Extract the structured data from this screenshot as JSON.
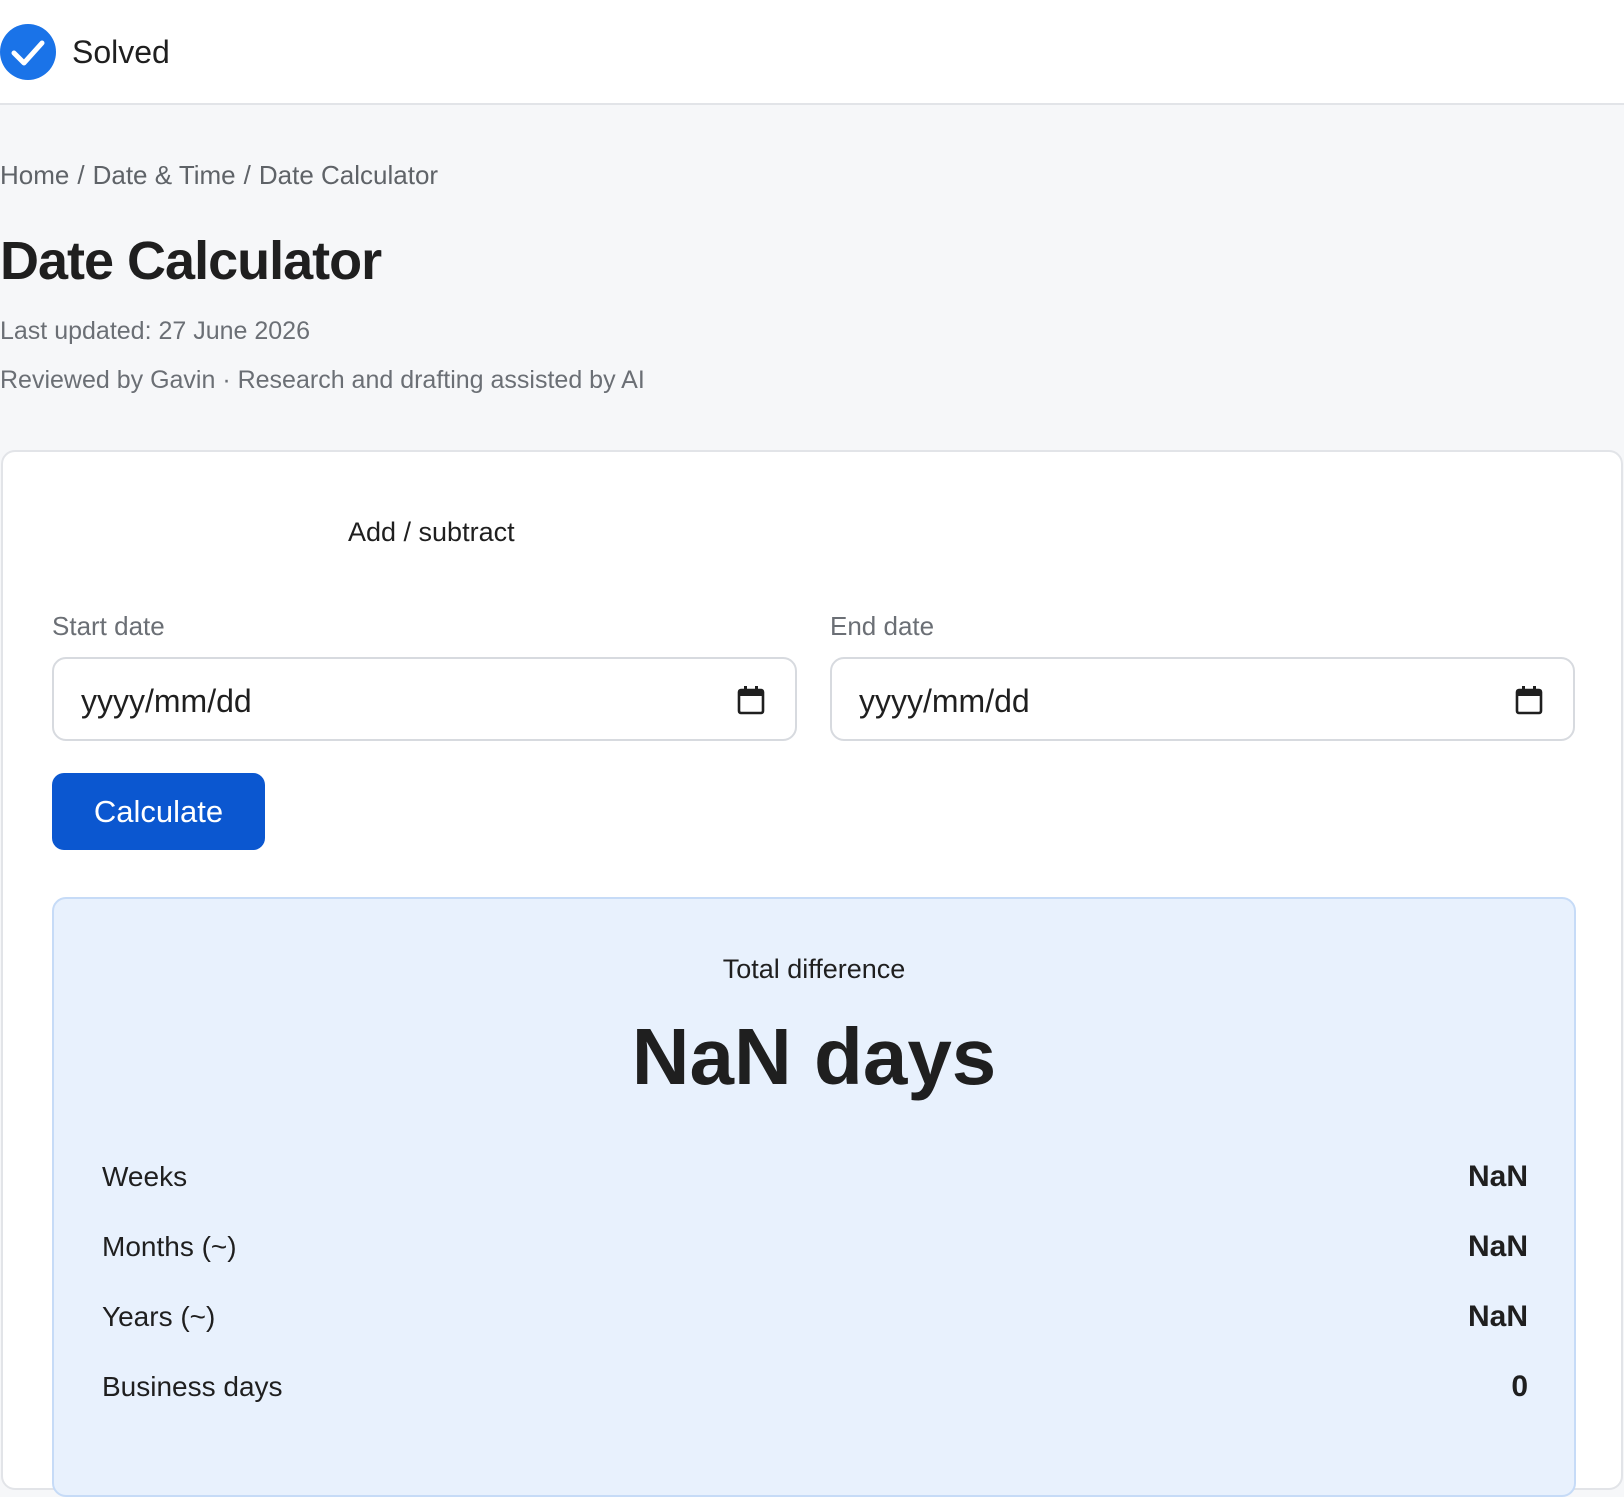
{
  "header": {
    "status_label": "Solved",
    "status_icon": "check-circle-icon",
    "accent_color": "#1a73e8"
  },
  "breadcrumb": {
    "items": [
      "Home",
      "Date & Time",
      "Date Calculator"
    ],
    "separator": "/"
  },
  "page": {
    "title": "Date Calculator",
    "last_updated": "Last updated: 27 June 2026",
    "reviewed": "Reviewed by Gavin · Research and drafting assisted by AI"
  },
  "calculator": {
    "tab_label": "Add / subtract",
    "start_label": "Start date",
    "start_placeholder": "yyyy/mm/dd",
    "end_label": "End date",
    "end_placeholder": "yyyy/mm/dd",
    "calendar_icon": "calendar-icon",
    "button_label": "Calculate",
    "button_color": "#0b57d0"
  },
  "result": {
    "caption": "Total difference",
    "total": "NaN days",
    "rows": [
      {
        "label": "Weeks",
        "value": "NaN"
      },
      {
        "label": "Months (~)",
        "value": "NaN"
      },
      {
        "label": "Years (~)",
        "value": "NaN"
      },
      {
        "label": "Business days",
        "value": "0"
      }
    ],
    "background_color": "#e8f1fd"
  }
}
